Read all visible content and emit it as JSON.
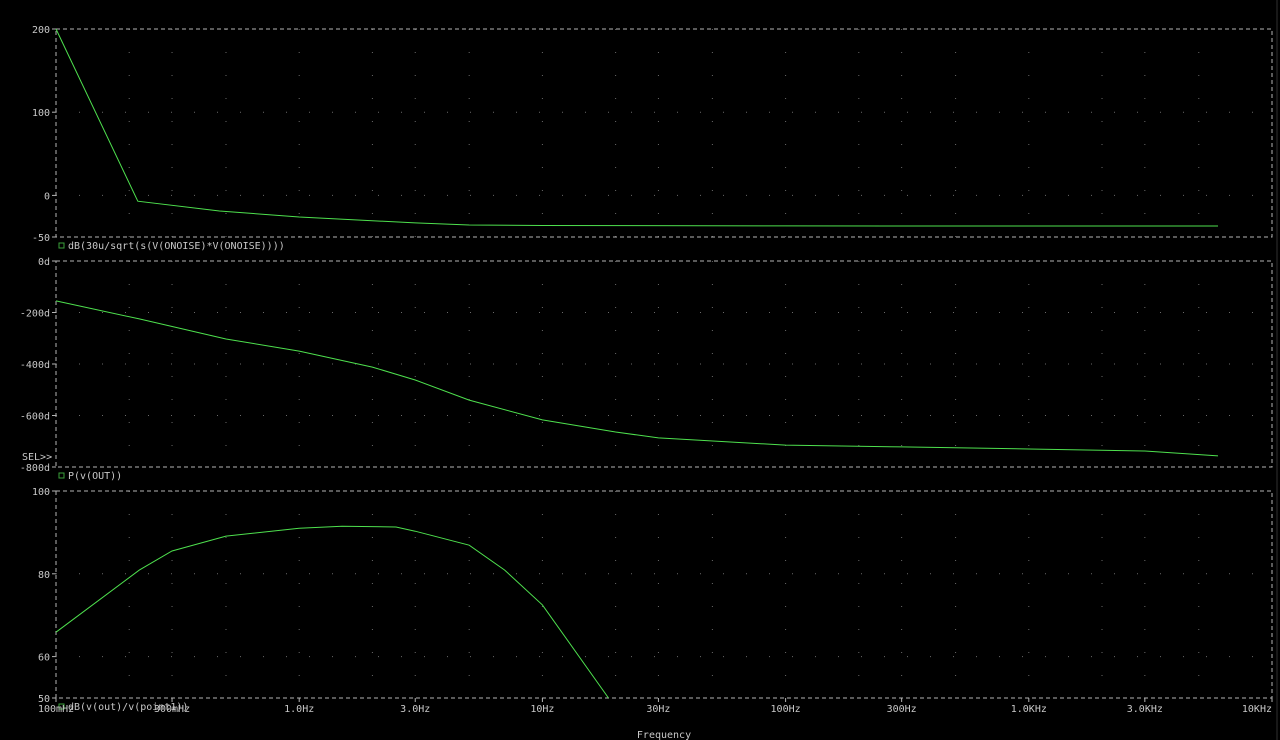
{
  "colors": {
    "background": "#000000",
    "trace": "#4ee04e",
    "axis": "#b4b4b4",
    "grid": "#6a6a6a",
    "marker": "#3aa03a"
  },
  "sel_marker": "SEL>>",
  "chart_data": [
    {
      "type": "line",
      "title": "",
      "xscale": "log",
      "xlim": [
        0.1,
        10000
      ],
      "ylim": [
        -50,
        200
      ],
      "yticks": [
        {
          "v": 200,
          "label": "200"
        },
        {
          "v": 100,
          "label": "100"
        },
        {
          "v": 0,
          "label": "0"
        },
        {
          "v": -50,
          "label": "-50"
        }
      ],
      "series": [
        {
          "name": "dB(30u/sqrt(s(V(ONOISE)*V(ONOISE))))",
          "x": [
            0.1,
            0.217,
            0.47,
            1.0,
            3.0,
            5.0,
            10,
            100,
            1000,
            6000
          ],
          "y": [
            200,
            -7,
            -18.7,
            -26,
            -33,
            -35.6,
            -36.2,
            -36.6,
            -36.8,
            -36.8
          ]
        }
      ]
    },
    {
      "type": "line",
      "title": "",
      "xscale": "log",
      "xlim": [
        0.1,
        10000
      ],
      "ylim": [
        -800,
        0
      ],
      "yticks": [
        {
          "v": 0,
          "label": "0d"
        },
        {
          "v": -200,
          "label": "-200d"
        },
        {
          "v": -400,
          "label": "-400d"
        },
        {
          "v": -600,
          "label": "-600d"
        },
        {
          "v": -800,
          "label": "-800d"
        }
      ],
      "series": [
        {
          "name": "P(v(OUT))",
          "x": [
            0.1,
            0.22,
            0.5,
            1,
            2,
            3,
            5,
            10,
            20,
            30,
            100,
            300,
            1000,
            3000,
            6000
          ],
          "y": [
            -155,
            -225,
            -303,
            -350,
            -412,
            -462,
            -540,
            -617,
            -664,
            -687,
            -715,
            -722,
            -730,
            -738,
            -757
          ]
        }
      ]
    },
    {
      "type": "line",
      "title": "",
      "xscale": "log",
      "xlim": [
        0.1,
        10000
      ],
      "ylim": [
        50,
        100
      ],
      "xlabel": "Frequency",
      "xticks": [
        {
          "v": 0.1,
          "label": "100mHz"
        },
        {
          "v": 0.3,
          "label": "300mHz"
        },
        {
          "v": 1,
          "label": "1.0Hz"
        },
        {
          "v": 3,
          "label": "3.0Hz"
        },
        {
          "v": 10,
          "label": "10Hz"
        },
        {
          "v": 30,
          "label": "30Hz"
        },
        {
          "v": 100,
          "label": "100Hz"
        },
        {
          "v": 300,
          "label": "300Hz"
        },
        {
          "v": 1000,
          "label": "1.0KHz"
        },
        {
          "v": 3000,
          "label": "3.0KHz"
        },
        {
          "v": 10000,
          "label": "10KHz"
        }
      ],
      "yticks": [
        {
          "v": 100,
          "label": "100"
        },
        {
          "v": 80,
          "label": "80"
        },
        {
          "v": 60,
          "label": "60"
        },
        {
          "v": 50,
          "label": "50"
        }
      ],
      "series": [
        {
          "name": "dB(v(out)/v(point1))",
          "x": [
            0.1,
            0.22,
            0.3,
            0.5,
            1,
            1.5,
            2.5,
            3,
            5,
            7,
            10,
            18.7
          ],
          "y": [
            65.9,
            80.9,
            85.5,
            89.1,
            91,
            91.5,
            91.3,
            90.3,
            86.9,
            80.9,
            72.5,
            50
          ]
        }
      ]
    }
  ]
}
